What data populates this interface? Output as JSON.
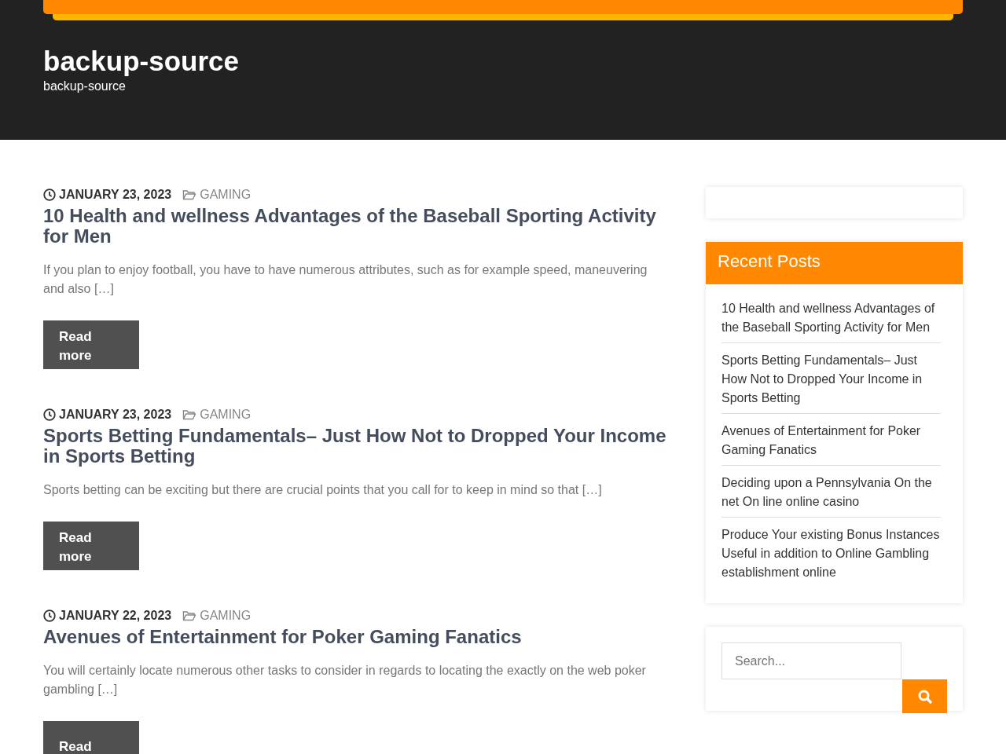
{
  "site": {
    "title": "backup-source",
    "tagline": "backup-source"
  },
  "posts": [
    {
      "date": "JANUARY 23, 2023",
      "category": "GAMING",
      "title": "10 Health and wellness Advantages of the Baseball Sporting Activity for Men",
      "excerpt": "If you plan to enjoy football, you have to have numerous attributes, such as for example speed, maneuvering and also […]",
      "button": "Read more"
    },
    {
      "date": "JANUARY 23, 2023",
      "category": "GAMING",
      "title": "Sports Betting Fundamentals– Just How Not to Dropped Your Income in Sports Betting",
      "excerpt": "Sports betting can be exciting but there are crucial points that you call for to keep in mind so that […]",
      "button": "Read more"
    },
    {
      "date": "JANUARY 22, 2023",
      "category": "GAMING",
      "title": "Avenues of Entertainment for Poker Gaming Fanatics",
      "excerpt": "You will certainly locate numerous other tasks to consider in regards to locating the exactly on the web poker gambling […]",
      "button": "Read"
    }
  ],
  "sidebar": {
    "recent_posts": {
      "title": "Recent Posts",
      "items": [
        "10 Health and wellness Advantages of the Baseball Sporting Activity for Men",
        "Sports Betting Fundamentals– Just How Not to Dropped Your Income in Sports Betting",
        "Avenues of Entertainment for Poker Gaming Fanatics",
        "Deciding upon a Pennsylvania On the net On line online casino",
        "Produce Your existing Bonus Instances Useful in addition to Online Gambling establishment online"
      ]
    },
    "search": {
      "placeholder": "Search..."
    }
  }
}
